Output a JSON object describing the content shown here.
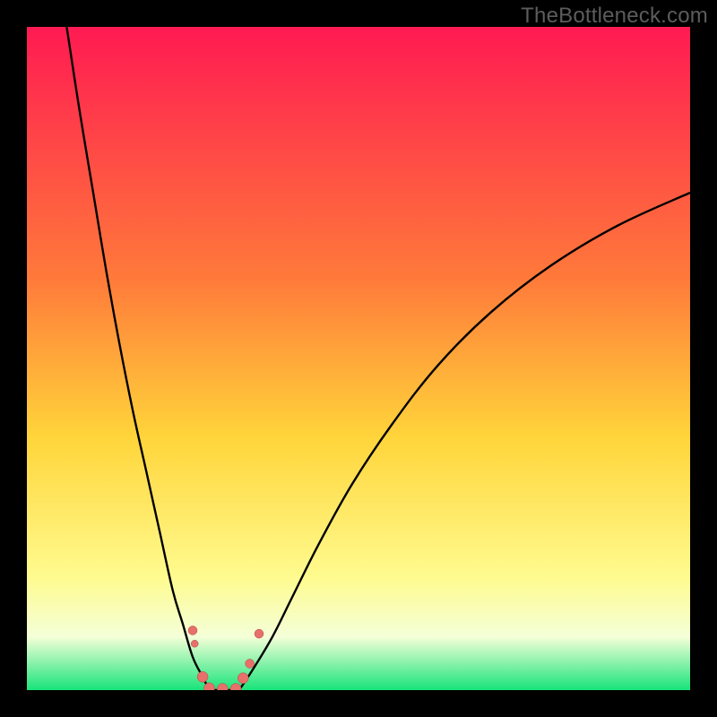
{
  "watermark": "TheBottleneck.com",
  "colors": {
    "bg": "#000000",
    "grad_top": "#ff1a52",
    "grad_mid1": "#ff7a3a",
    "grad_mid2": "#ffd53a",
    "grad_low": "#fffb8f",
    "grad_pale": "#f4ffd8",
    "grad_bottom": "#18e47a",
    "curve": "#000000",
    "marker_fill": "#e7706a",
    "marker_stroke": "#b34b46"
  },
  "chart_data": {
    "type": "line",
    "title": "",
    "xlabel": "",
    "ylabel": "",
    "xlim": [
      0,
      100
    ],
    "ylim": [
      0,
      100
    ],
    "series": [
      {
        "name": "left-curve",
        "x": [
          6,
          8,
          10,
          12,
          14,
          16,
          18,
          20,
          22,
          23.5,
          25,
          26.5,
          27.5
        ],
        "y": [
          100,
          87,
          75,
          63,
          52,
          42,
          33,
          24,
          15,
          10,
          5,
          2,
          0
        ]
      },
      {
        "name": "right-curve",
        "x": [
          32,
          34,
          37,
          40,
          44,
          49,
          55,
          62,
          70,
          79,
          89,
          100
        ],
        "y": [
          0,
          3,
          8,
          14,
          22,
          31,
          40,
          49,
          57,
          64,
          70,
          75
        ]
      },
      {
        "name": "floor",
        "x": [
          27.5,
          32
        ],
        "y": [
          0,
          0
        ]
      }
    ],
    "markers": [
      {
        "x": 25.0,
        "y": 9.0,
        "r": 5
      },
      {
        "x": 25.3,
        "y": 7.0,
        "r": 4
      },
      {
        "x": 26.5,
        "y": 2.0,
        "r": 6
      },
      {
        "x": 27.5,
        "y": 0.3,
        "r": 6
      },
      {
        "x": 29.5,
        "y": 0.2,
        "r": 6
      },
      {
        "x": 31.5,
        "y": 0.2,
        "r": 6
      },
      {
        "x": 32.6,
        "y": 1.8,
        "r": 6
      },
      {
        "x": 33.6,
        "y": 4.0,
        "r": 5
      },
      {
        "x": 35.0,
        "y": 8.5,
        "r": 5
      }
    ]
  }
}
